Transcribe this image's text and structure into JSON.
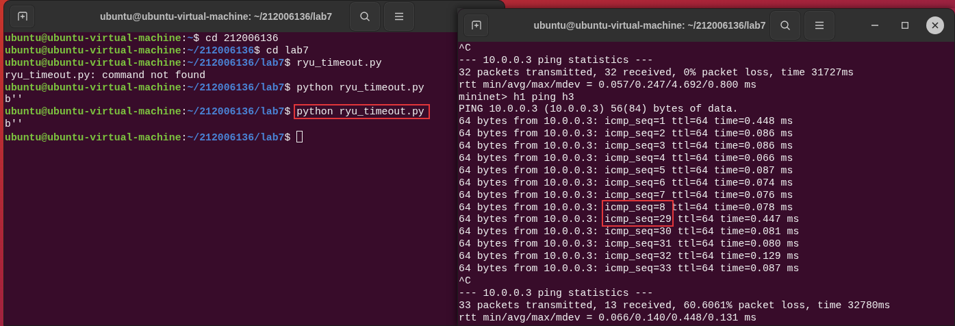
{
  "windows": [
    {
      "title": "ubuntu@ubuntu-virtual-machine: ~/212006136/lab7",
      "window_controls": false,
      "lines": [
        {
          "kind": "prompt",
          "user": "ubuntu@ubuntu-virtual-machine",
          "separator": ":",
          "path": "~",
          "prompt_end": "$",
          "command": "cd 212006136"
        },
        {
          "kind": "prompt",
          "user": "ubuntu@ubuntu-virtual-machine",
          "separator": ":",
          "path": "~/212006136",
          "prompt_end": "$",
          "command": "cd lab7"
        },
        {
          "kind": "prompt",
          "user": "ubuntu@ubuntu-virtual-machine",
          "separator": ":",
          "path": "~/212006136/lab7",
          "prompt_end": "$",
          "command": "ryu_timeout.py"
        },
        {
          "kind": "output",
          "text": "ryu_timeout.py: command not found"
        },
        {
          "kind": "prompt",
          "user": "ubuntu@ubuntu-virtual-machine",
          "separator": ":",
          "path": "~/212006136/lab7",
          "prompt_end": "$",
          "command": "python ryu_timeout.py"
        },
        {
          "kind": "output",
          "text": "b''"
        },
        {
          "kind": "prompt",
          "user": "ubuntu@ubuntu-virtual-machine",
          "separator": ":",
          "path": "~/212006136/lab7",
          "prompt_end": "$",
          "command": "python ryu_timeout.py",
          "highlighted": true
        },
        {
          "kind": "output",
          "text": "b''"
        },
        {
          "kind": "prompt",
          "user": "ubuntu@ubuntu-virtual-machine",
          "separator": ":",
          "path": "~/212006136/lab7",
          "prompt_end": "$",
          "cursor": true
        }
      ]
    },
    {
      "title": "ubuntu@ubuntu-virtual-machine: ~/212006136/lab7",
      "window_controls": true,
      "lines": [
        {
          "kind": "output",
          "text": "^C"
        },
        {
          "kind": "output",
          "text": "--- 10.0.0.3 ping statistics ---"
        },
        {
          "kind": "output",
          "text": "32 packets transmitted, 32 received, 0% packet loss, time 31727ms"
        },
        {
          "kind": "output",
          "text": "rtt min/avg/max/mdev = 0.057/0.247/4.692/0.800 ms"
        },
        {
          "kind": "output",
          "text": "mininet> h1 ping h3"
        },
        {
          "kind": "output",
          "text": "PING 10.0.0.3 (10.0.0.3) 56(84) bytes of data."
        },
        {
          "kind": "output",
          "text": "64 bytes from 10.0.0.3: icmp_seq=1 ttl=64 time=0.448 ms"
        },
        {
          "kind": "output",
          "text": "64 bytes from 10.0.0.3: icmp_seq=2 ttl=64 time=0.086 ms"
        },
        {
          "kind": "output",
          "text": "64 bytes from 10.0.0.3: icmp_seq=3 ttl=64 time=0.086 ms"
        },
        {
          "kind": "output",
          "text": "64 bytes from 10.0.0.3: icmp_seq=4 ttl=64 time=0.066 ms"
        },
        {
          "kind": "output",
          "text": "64 bytes from 10.0.0.3: icmp_seq=5 ttl=64 time=0.087 ms"
        },
        {
          "kind": "output",
          "text": "64 bytes from 10.0.0.3: icmp_seq=6 ttl=64 time=0.074 ms"
        },
        {
          "kind": "output",
          "text": "64 bytes from 10.0.0.3: icmp_seq=7 ttl=64 time=0.076 ms"
        },
        {
          "kind": "marked_output",
          "before": "64 bytes from 10.0.0.3:",
          "marked": "icmp_seq=8",
          "after": "ttl=64 time=0.078 ms",
          "highlighted": true
        },
        {
          "kind": "marked_output",
          "before": "64 bytes from 10.0.0.3:",
          "marked": "icmp_seq=29",
          "after": "ttl=64 time=0.447 ms",
          "highlighted": true
        },
        {
          "kind": "output",
          "text": "64 bytes from 10.0.0.3: icmp_seq=30 ttl=64 time=0.081 ms"
        },
        {
          "kind": "output",
          "text": "64 bytes from 10.0.0.3: icmp_seq=31 ttl=64 time=0.080 ms"
        },
        {
          "kind": "output",
          "text": "64 bytes from 10.0.0.3: icmp_seq=32 ttl=64 time=0.129 ms"
        },
        {
          "kind": "output",
          "text": "64 bytes from 10.0.0.3: icmp_seq=33 ttl=64 time=0.087 ms"
        },
        {
          "kind": "output",
          "text": "^C"
        },
        {
          "kind": "output",
          "text": "--- 10.0.0.3 ping statistics ---"
        },
        {
          "kind": "output",
          "text": "33 packets transmitted, 13 received, 60.6061% packet loss, time 32780ms"
        },
        {
          "kind": "output",
          "text": "rtt min/avg/max/mdev = 0.066/0.140/0.448/0.131 ms"
        }
      ]
    }
  ]
}
